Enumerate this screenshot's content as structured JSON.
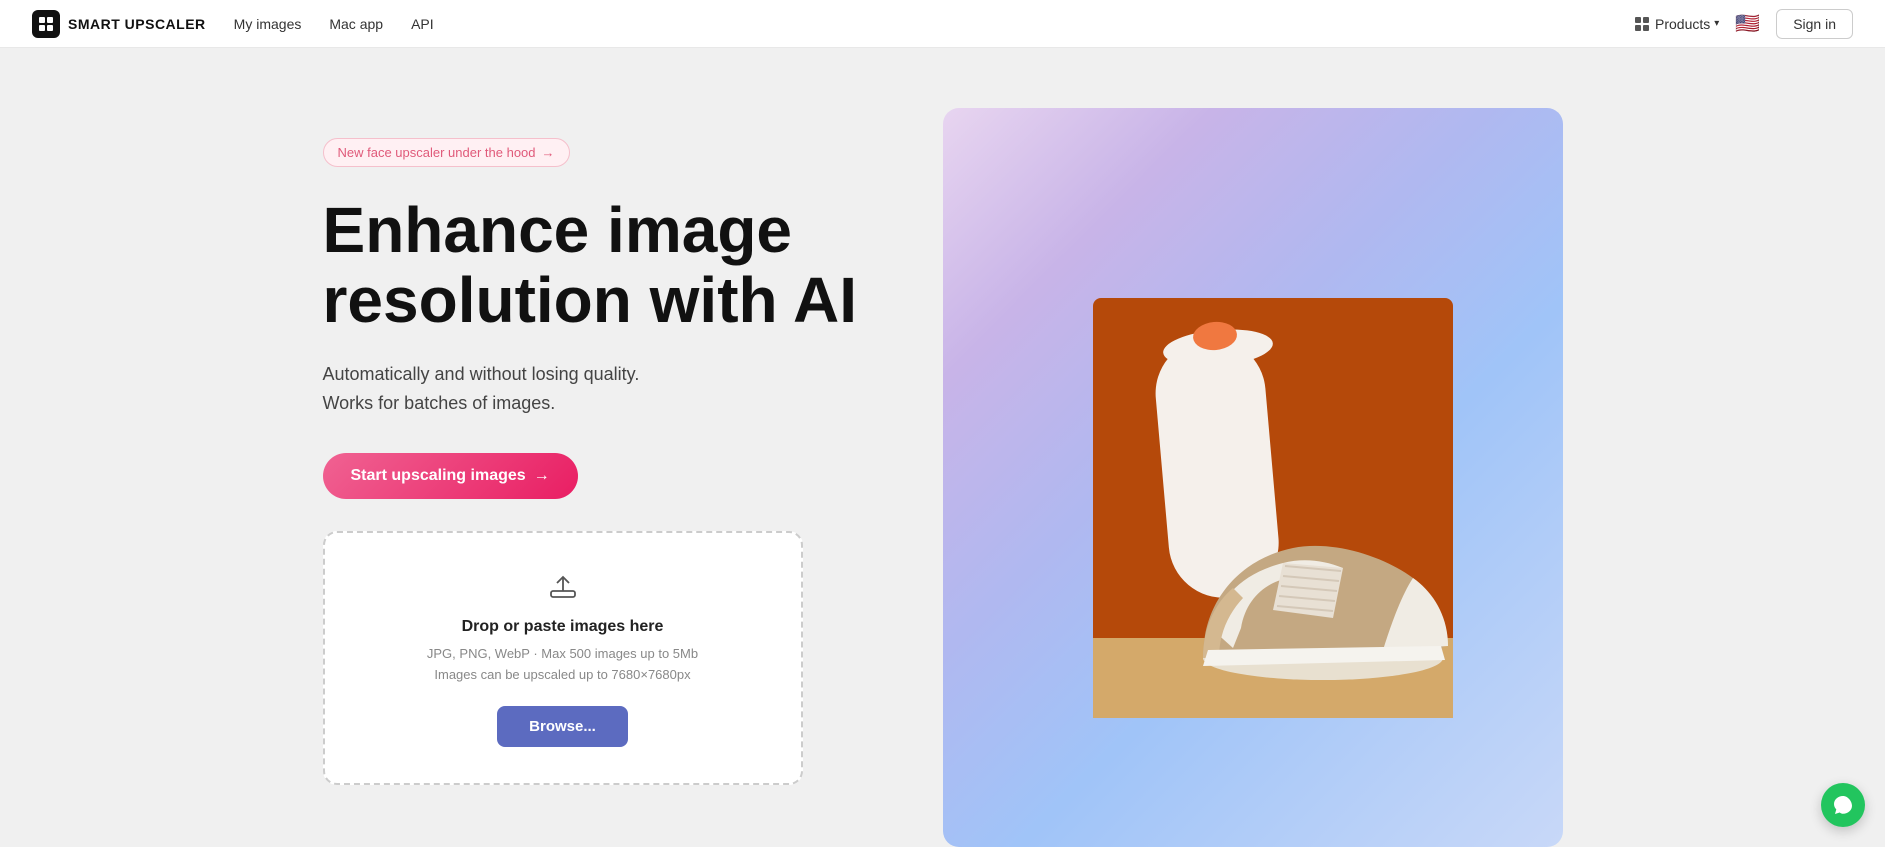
{
  "nav": {
    "logo_text": "SMART UPSCALER",
    "links": [
      {
        "id": "my-images",
        "label": "My images"
      },
      {
        "id": "mac-app",
        "label": "Mac app"
      },
      {
        "id": "api",
        "label": "API"
      }
    ],
    "products_label": "Products",
    "sign_in_label": "Sign in"
  },
  "hero": {
    "badge_text": "New face upscaler under the hood",
    "badge_arrow": "→",
    "title_line1": "Enhance image",
    "title_line2": "resolution with AI",
    "subtitle_line1": "Automatically and without losing quality.",
    "subtitle_line2": "Works for batches of images.",
    "cta_label": "Start upscaling images",
    "cta_arrow": "→"
  },
  "dropzone": {
    "drop_title": "Drop or paste images here",
    "drop_sub_line1": "JPG, PNG, WebP · Max 500 images up to 5Mb",
    "drop_sub_line2": "Images can be upscaled up to 7680×7680px",
    "browse_label": "Browse..."
  }
}
